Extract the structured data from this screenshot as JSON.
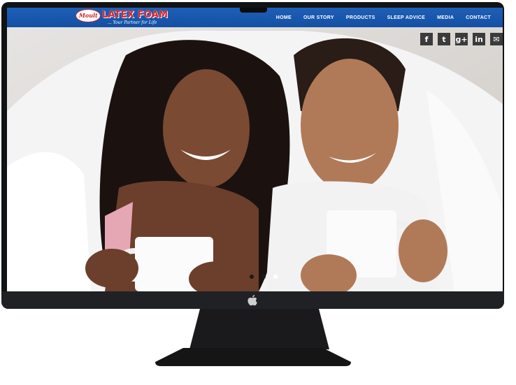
{
  "site": {
    "logo_text": "LATEX FOAM",
    "tagline": "... Your Partner for Life"
  },
  "nav": [
    {
      "label": "HOME"
    },
    {
      "label": "OUR STORY"
    },
    {
      "label": "PRODUCTS"
    },
    {
      "label": "SLEEP ADVICE"
    },
    {
      "label": "MEDIA"
    },
    {
      "label": "CONTACT"
    }
  ],
  "social": [
    {
      "icon": "facebook-icon",
      "glyph": "f"
    },
    {
      "icon": "twitter-icon",
      "glyph": "t"
    },
    {
      "icon": "google-plus-icon",
      "glyph": "g+"
    },
    {
      "icon": "linkedin-icon",
      "glyph": "in"
    },
    {
      "icon": "email-icon",
      "glyph": "✉"
    }
  ],
  "slider": {
    "total": 3,
    "active": 3
  }
}
